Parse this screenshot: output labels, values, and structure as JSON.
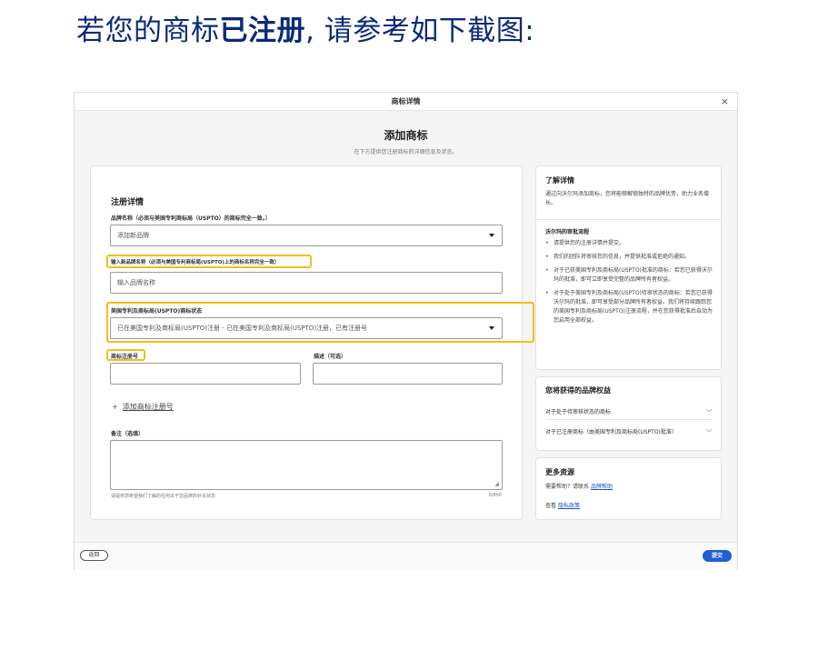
{
  "heading": {
    "prefix": "若您的商标",
    "bold": "已注册",
    "suffix": ", 请参考如下截图:"
  },
  "dialog": {
    "window_title": "商标详情",
    "close_symbol": "×",
    "page_title": "添加商标",
    "page_subtitle": "在下方提供您注册商标的详细信息及状态。"
  },
  "form": {
    "section_title": "注册详情",
    "brand_name_label": "品牌名称（必须与美国专利商标局（USPTO）的商标完全一致。）",
    "brand_name_value": "添加新品牌",
    "new_brand_label": "输入新品牌名称（必须与美国专利商标局(USPTO)上的商标名称完全一致）",
    "new_brand_placeholder": "输入品牌名称",
    "status_label": "美国专利及商标局(USPTO)商标状态",
    "status_value": "已在美国专利及商标局(USPTO)注册 - 已在美国专利及商标局(USPTO)注册，已有注册号",
    "reg_no_label": "商标注册号",
    "desc_label": "描述（可选）",
    "add_reg_plus": "+",
    "add_reg_link": "添加商标注册号",
    "notes_label": "备注（选填）",
    "notes_resize": "◢",
    "notes_hint": "请提供您希望我们了解的任何关于您品牌的补充状态",
    "notes_count": "0/800"
  },
  "side": {
    "learn_title": "了解详情",
    "learn_text": "通过向沃尔玛添加商标，您将能够解锁独特的品牌优势，助力业务增长。",
    "process_title": "沃尔玛的审批流程",
    "process_items": [
      "请提供您的注册详情并提交。",
      "我们的团队将审核您的信息，并提供批准或拒绝的通知。",
      "对于已获美国专利及商标局(USPTO)批准的商标：若您已获得沃尔玛的批准，即可立即享受完整的品牌所有者权益。",
      "对于处于美国专利及商标局(USPTO)待审状态的商标：若您已获得沃尔玛的批准，即可享受部分品牌所有者权益。我们将持续跟踪您的美国专利及商标局(USPTO)注册流程，并在您获得批准后自动为您启用全部权益。"
    ],
    "benefits_title": "您将获得的品牌权益",
    "benefit_rows": [
      "对于处于待审核状态的商标",
      "对于已注册商标（由美国专利及商标局(USPTO)批准）"
    ],
    "chevron_symbol": "⌵",
    "resources_title": "更多资源",
    "help_prefix": "需要帮助？请联系",
    "help_link": "品牌帮助",
    "privacy_prefix": "查看",
    "privacy_link": "隐私政策"
  },
  "footer": {
    "back_label": "返回",
    "submit_label": "提交"
  },
  "colors": {
    "heading": "#0b2a78",
    "highlight": "#f2bf1a",
    "primary": "#1f5fd6"
  }
}
